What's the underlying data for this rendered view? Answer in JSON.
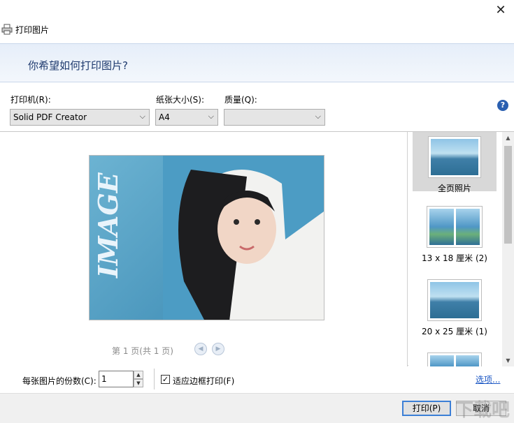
{
  "window": {
    "title": "打印图片",
    "close_glyph": "✕"
  },
  "banner": {
    "heading": "你希望如何打印图片?"
  },
  "settings": {
    "printer_label": "打印机(R):",
    "printer_value": "Solid PDF Creator",
    "paper_label": "纸张大小(S):",
    "paper_value": "A4",
    "quality_label": "质量(Q):",
    "quality_value": ""
  },
  "preview": {
    "image_text": "IMAGE",
    "pager_text": "第 1 页(共 1 页)"
  },
  "layouts": [
    {
      "label": "全页照片",
      "selected": true
    },
    {
      "label": "13 x 18 厘米 (2)",
      "selected": false
    },
    {
      "label": "20 x 25 厘米 (1)",
      "selected": false
    }
  ],
  "bottom": {
    "copies_label": "每张图片的份数(C):",
    "copies_value": "1",
    "fit_label": "适应边框打印(F)",
    "fit_checked": true,
    "options_link": "选项..."
  },
  "buttons": {
    "print": "打印(P)",
    "cancel": "取消"
  },
  "watermark": "下载吧",
  "colors": {
    "accent": "#3c7fd6",
    "banner_text": "#1e3a6e",
    "link": "#1a56c4"
  },
  "icons": [
    "printer-icon",
    "close-icon",
    "help-icon",
    "chevron-down-icon",
    "prev-page-icon",
    "next-page-icon"
  ]
}
